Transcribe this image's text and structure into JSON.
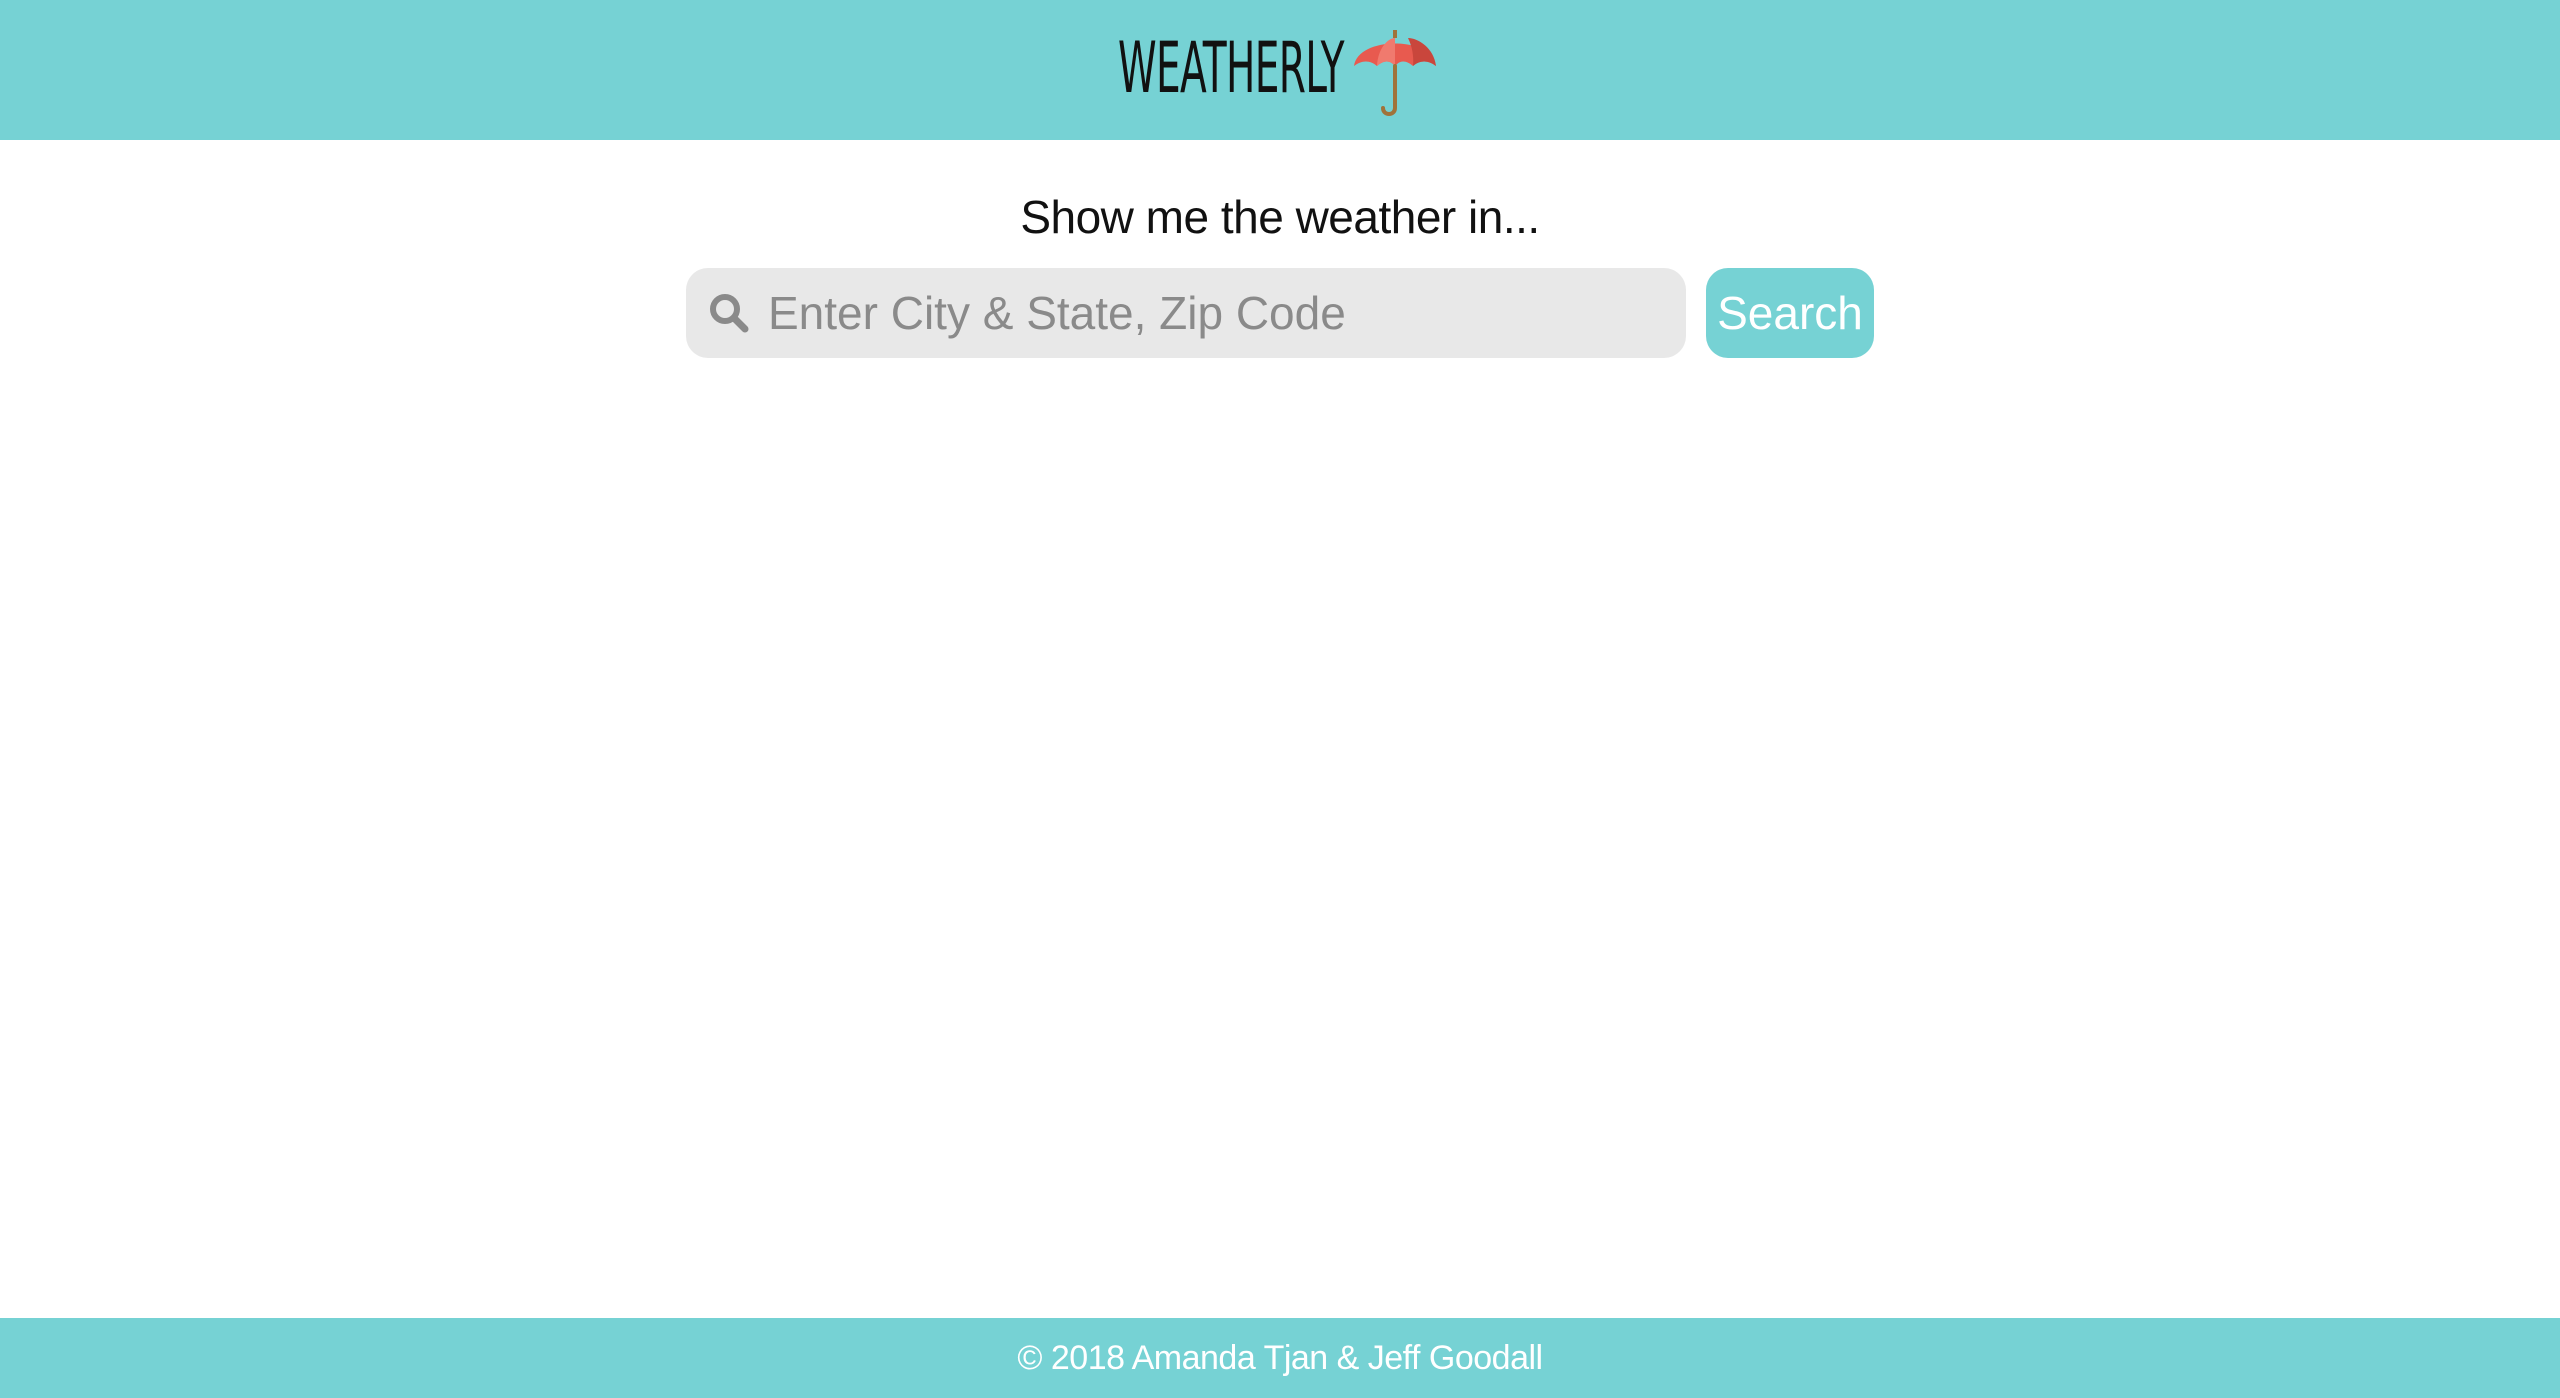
{
  "header": {
    "logo_text": "WEATHERLY",
    "logo_icon": "umbrella-icon",
    "background_color": "#76d2d4"
  },
  "main": {
    "prompt": "Show me the weather in...",
    "search": {
      "icon": "search-icon",
      "value": "",
      "placeholder": "Enter City & State, Zip Code",
      "button_label": "Search"
    }
  },
  "footer": {
    "text": "© 2018 Amanda Tjan & Jeff Goodall"
  },
  "colors": {
    "accent": "#76d2d4",
    "input_background": "#e8e8e8",
    "umbrella_canopy": "#e85a4f",
    "umbrella_handle": "#a0733a"
  }
}
